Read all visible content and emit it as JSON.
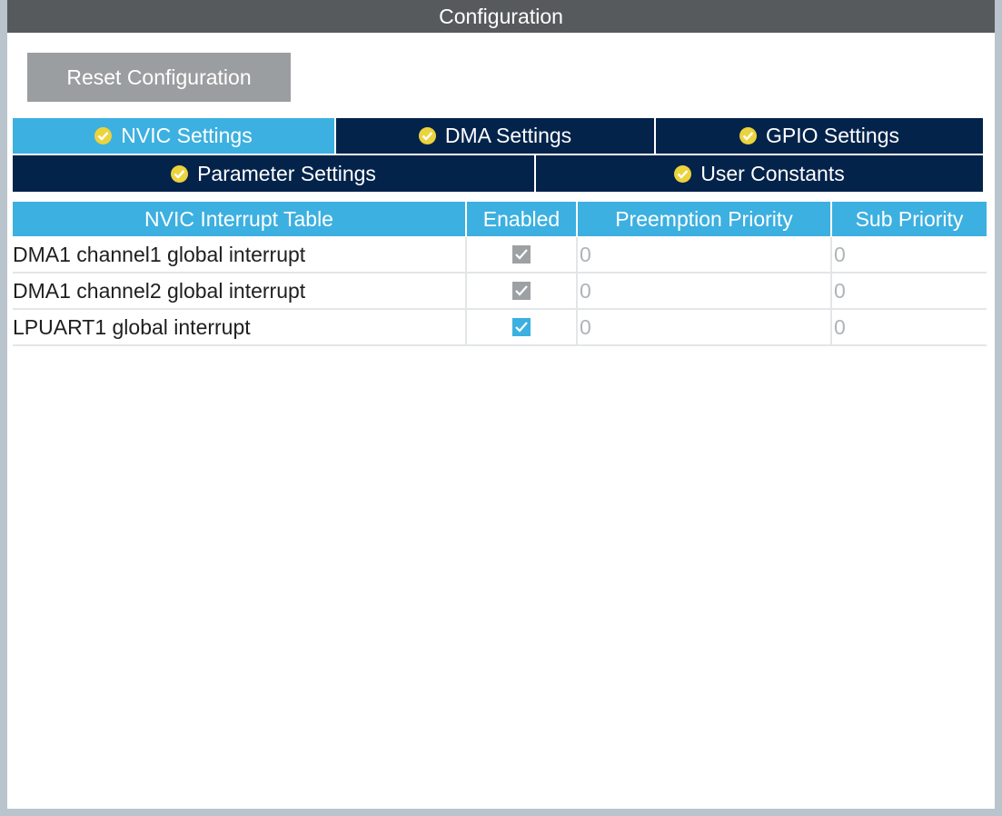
{
  "window": {
    "title": "Configuration"
  },
  "toolbar": {
    "reset_label": "Reset Configuration"
  },
  "tabs": {
    "row1": [
      {
        "label": "NVIC Settings",
        "active": true
      },
      {
        "label": "DMA Settings",
        "active": false
      },
      {
        "label": "GPIO Settings",
        "active": false
      }
    ],
    "row2": [
      {
        "label": "Parameter Settings",
        "active": false
      },
      {
        "label": "User Constants",
        "active": false
      }
    ],
    "icon": "check-circle-icon",
    "colors": {
      "active": "#3cb0e0",
      "inactive": "#03234b",
      "check": "#ecd33c"
    }
  },
  "table": {
    "headers": [
      "NVIC Interrupt Table",
      "Enabled",
      "Preemption Priority",
      "Sub Priority"
    ],
    "rows": [
      {
        "name": "DMA1 channel1 global interrupt",
        "enabled": true,
        "editable": false,
        "preemption": "0",
        "sub": "0"
      },
      {
        "name": "DMA1 channel2 global interrupt",
        "enabled": true,
        "editable": false,
        "preemption": "0",
        "sub": "0"
      },
      {
        "name": "LPUART1 global interrupt",
        "enabled": true,
        "editable": true,
        "preemption": "0",
        "sub": "0"
      }
    ]
  }
}
